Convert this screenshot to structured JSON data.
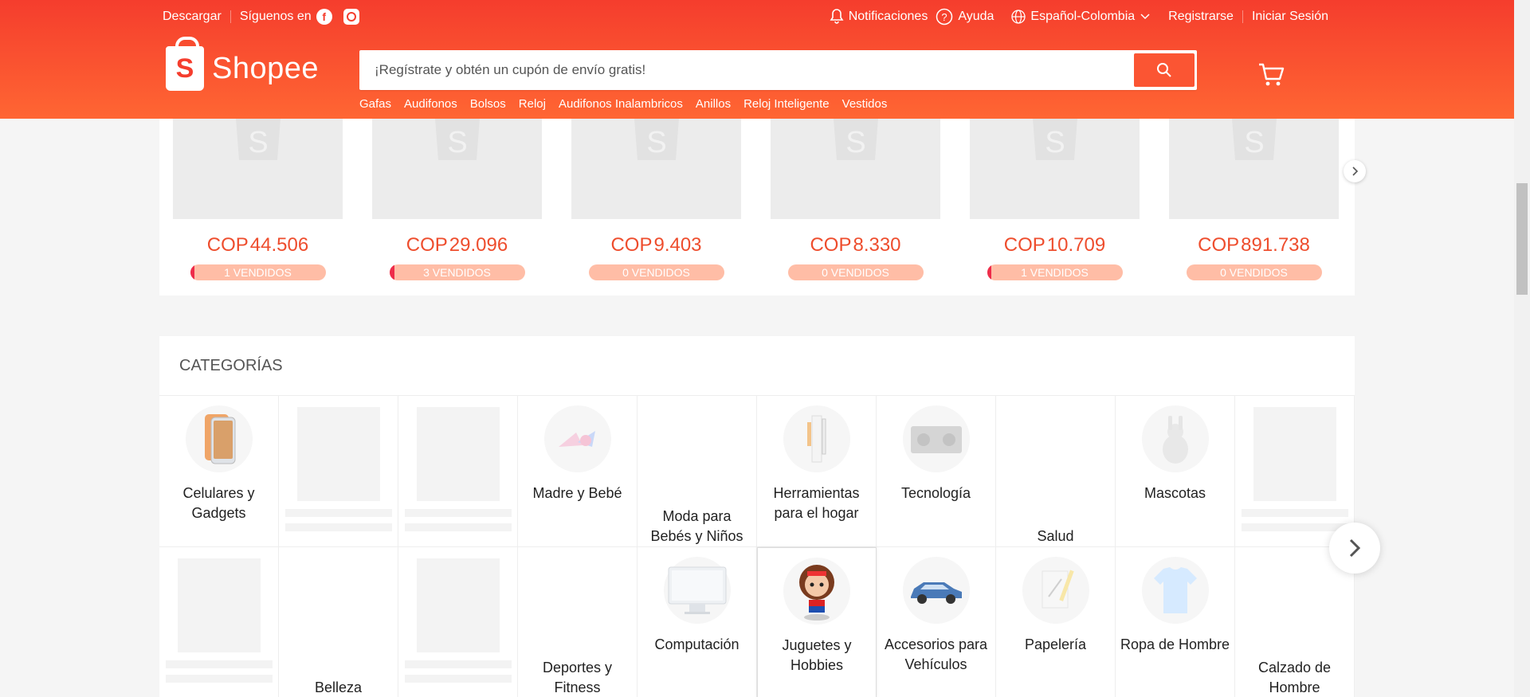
{
  "topbar": {
    "download": "Descargar",
    "follow": "Síguenos en",
    "facebook_icon": "facebook-icon",
    "instagram_icon": "instagram-icon",
    "notifications": "Notificaciones",
    "help": "Ayuda",
    "language": "Español-Colombia",
    "register": "Registrarse",
    "login": "Iniciar Sesión"
  },
  "brand": {
    "name": "Shopee",
    "color": "#ee4d2d"
  },
  "search": {
    "placeholder": "¡Regístrate y obtén un cupón de envío gratis!",
    "value": "",
    "quick_links": [
      "Gafas",
      "Audifonos",
      "Bolsos",
      "Reloj",
      "Audifonos Inalambricos",
      "Anillos",
      "Reloj Inteligente",
      "Vestidos"
    ]
  },
  "products": [
    {
      "currency": "COP",
      "price": "44.506",
      "sold": "1 VENDIDOS",
      "sold_fraction": 0.01
    },
    {
      "currency": "COP",
      "price": "29.096",
      "sold": "3 VENDIDOS",
      "sold_fraction": 0.04
    },
    {
      "currency": "COP",
      "price": "9.403",
      "sold": "0 VENDIDOS",
      "sold_fraction": 0
    },
    {
      "currency": "COP",
      "price": "8.330",
      "sold": "0 VENDIDOS",
      "sold_fraction": 0
    },
    {
      "currency": "COP",
      "price": "10.709",
      "sold": "1 VENDIDOS",
      "sold_fraction": 0.01
    },
    {
      "currency": "COP",
      "price": "891.738",
      "sold": "0 VENDIDOS",
      "sold_fraction": 0
    }
  ],
  "categories": {
    "title": "CATEGORÍAS",
    "items": [
      {
        "name": "Celulares y Gadgets",
        "icon": "phone-icon"
      },
      {
        "name": "",
        "icon": "placeholder"
      },
      {
        "name": "",
        "icon": "placeholder"
      },
      {
        "name": "Madre y Bebé",
        "icon": "baby-icon"
      },
      {
        "name": "Moda para Bebés y Niños",
        "icon": "kids-fashion-icon"
      },
      {
        "name": "Herramientas para el hogar",
        "icon": "tools-icon"
      },
      {
        "name": "Tecnología",
        "icon": "speaker-icon"
      },
      {
        "name": "Salud",
        "icon": "health-icon"
      },
      {
        "name": "Mascotas",
        "icon": "pet-icon"
      },
      {
        "name": "",
        "icon": "placeholder"
      },
      {
        "name": "",
        "icon": "placeholder"
      },
      {
        "name": "Belleza",
        "icon": "beauty-icon"
      },
      {
        "name": "",
        "icon": "placeholder"
      },
      {
        "name": "Deportes y Fitness",
        "icon": "sports-icon"
      },
      {
        "name": "Computación",
        "icon": "monitor-icon"
      },
      {
        "name": "Juguetes y Hobbies",
        "icon": "toy-icon"
      },
      {
        "name": "Accesorios para Vehículos",
        "icon": "car-icon"
      },
      {
        "name": "Papelería",
        "icon": "stationery-icon"
      },
      {
        "name": "Ropa de Hombre",
        "icon": "shirt-icon"
      },
      {
        "name": "Calzado de Hombre",
        "icon": "shoe-icon"
      }
    ]
  }
}
